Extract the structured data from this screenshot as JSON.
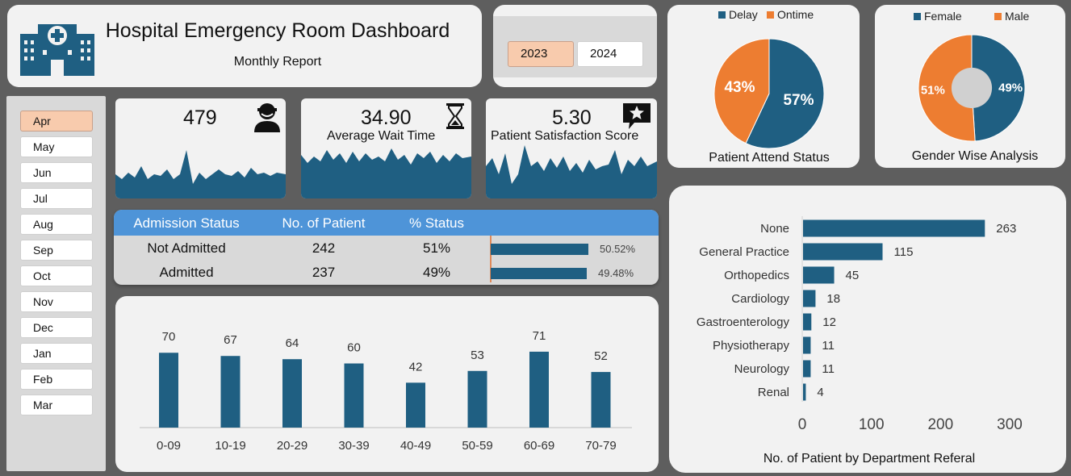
{
  "header": {
    "title": "Hospital Emergency Room Dashboard",
    "subtitle": "Monthly Report"
  },
  "years": [
    {
      "label": "2023",
      "selected": true
    },
    {
      "label": "2024",
      "selected": false
    }
  ],
  "months": [
    {
      "label": "Apr",
      "selected": true
    },
    {
      "label": "May"
    },
    {
      "label": "Jun"
    },
    {
      "label": "Jul"
    },
    {
      "label": "Aug"
    },
    {
      "label": "Sep"
    },
    {
      "label": "Oct"
    },
    {
      "label": "Nov"
    },
    {
      "label": "Dec"
    },
    {
      "label": "Jan"
    },
    {
      "label": "Feb"
    },
    {
      "label": "Mar"
    }
  ],
  "kpis": {
    "patients": {
      "value": "479",
      "icon": "user-icon"
    },
    "wait_time": {
      "value": "34.90",
      "label": "Average Wait Time",
      "icon": "hourglass-icon"
    },
    "satisfaction": {
      "value": "5.30",
      "label": "Patient Satisfaction Score",
      "icon": "star-review-icon"
    }
  },
  "admission": {
    "headers": [
      "Admission Status",
      "No. of Patient",
      "% Status"
    ],
    "rows": [
      {
        "status": "Not Admitted",
        "count": "242",
        "pct": "51%",
        "bar_pct_label": "50.52%",
        "share": 0.5052
      },
      {
        "status": "Admitted",
        "count": "237",
        "pct": "49%",
        "bar_pct_label": "49.48%",
        "share": 0.4948
      }
    ]
  },
  "colors": {
    "primary": "#1f5f82",
    "accent": "#ed7d31",
    "selected": "#f8cbad",
    "header_blue": "#4e94d8"
  },
  "chart_data": [
    {
      "type": "bar",
      "categories": [
        "0-09",
        "10-19",
        "20-29",
        "30-39",
        "40-49",
        "50-59",
        "60-69",
        "70-79"
      ],
      "values": [
        70,
        67,
        64,
        60,
        42,
        53,
        71,
        52
      ],
      "title": "",
      "xlabel": "",
      "ylabel": "",
      "ylim": [
        0,
        80
      ]
    },
    {
      "type": "pie",
      "title": "Patient Attend Status",
      "categories": [
        "Delay",
        "Ontime"
      ],
      "values": [
        57,
        43
      ],
      "labels": [
        "57%",
        "43%"
      ],
      "legend": "top"
    },
    {
      "type": "pie",
      "title": "Gender Wise Analysis",
      "categories": [
        "Female",
        "Male"
      ],
      "values": [
        49,
        51
      ],
      "labels": [
        "49%",
        "51%"
      ],
      "legend": "top"
    },
    {
      "type": "bar",
      "orientation": "horizontal",
      "title": "No. of Patient by Department Referal",
      "categories": [
        "None",
        "General Practice",
        "Orthopedics",
        "Cardiology",
        "Gastroenterology",
        "Physiotherapy",
        "Neurology",
        "Renal"
      ],
      "values": [
        263,
        115,
        45,
        18,
        12,
        11,
        11,
        4
      ],
      "xlim": [
        0,
        300
      ],
      "xticks": [
        "0",
        "100",
        "200",
        "300"
      ]
    }
  ]
}
